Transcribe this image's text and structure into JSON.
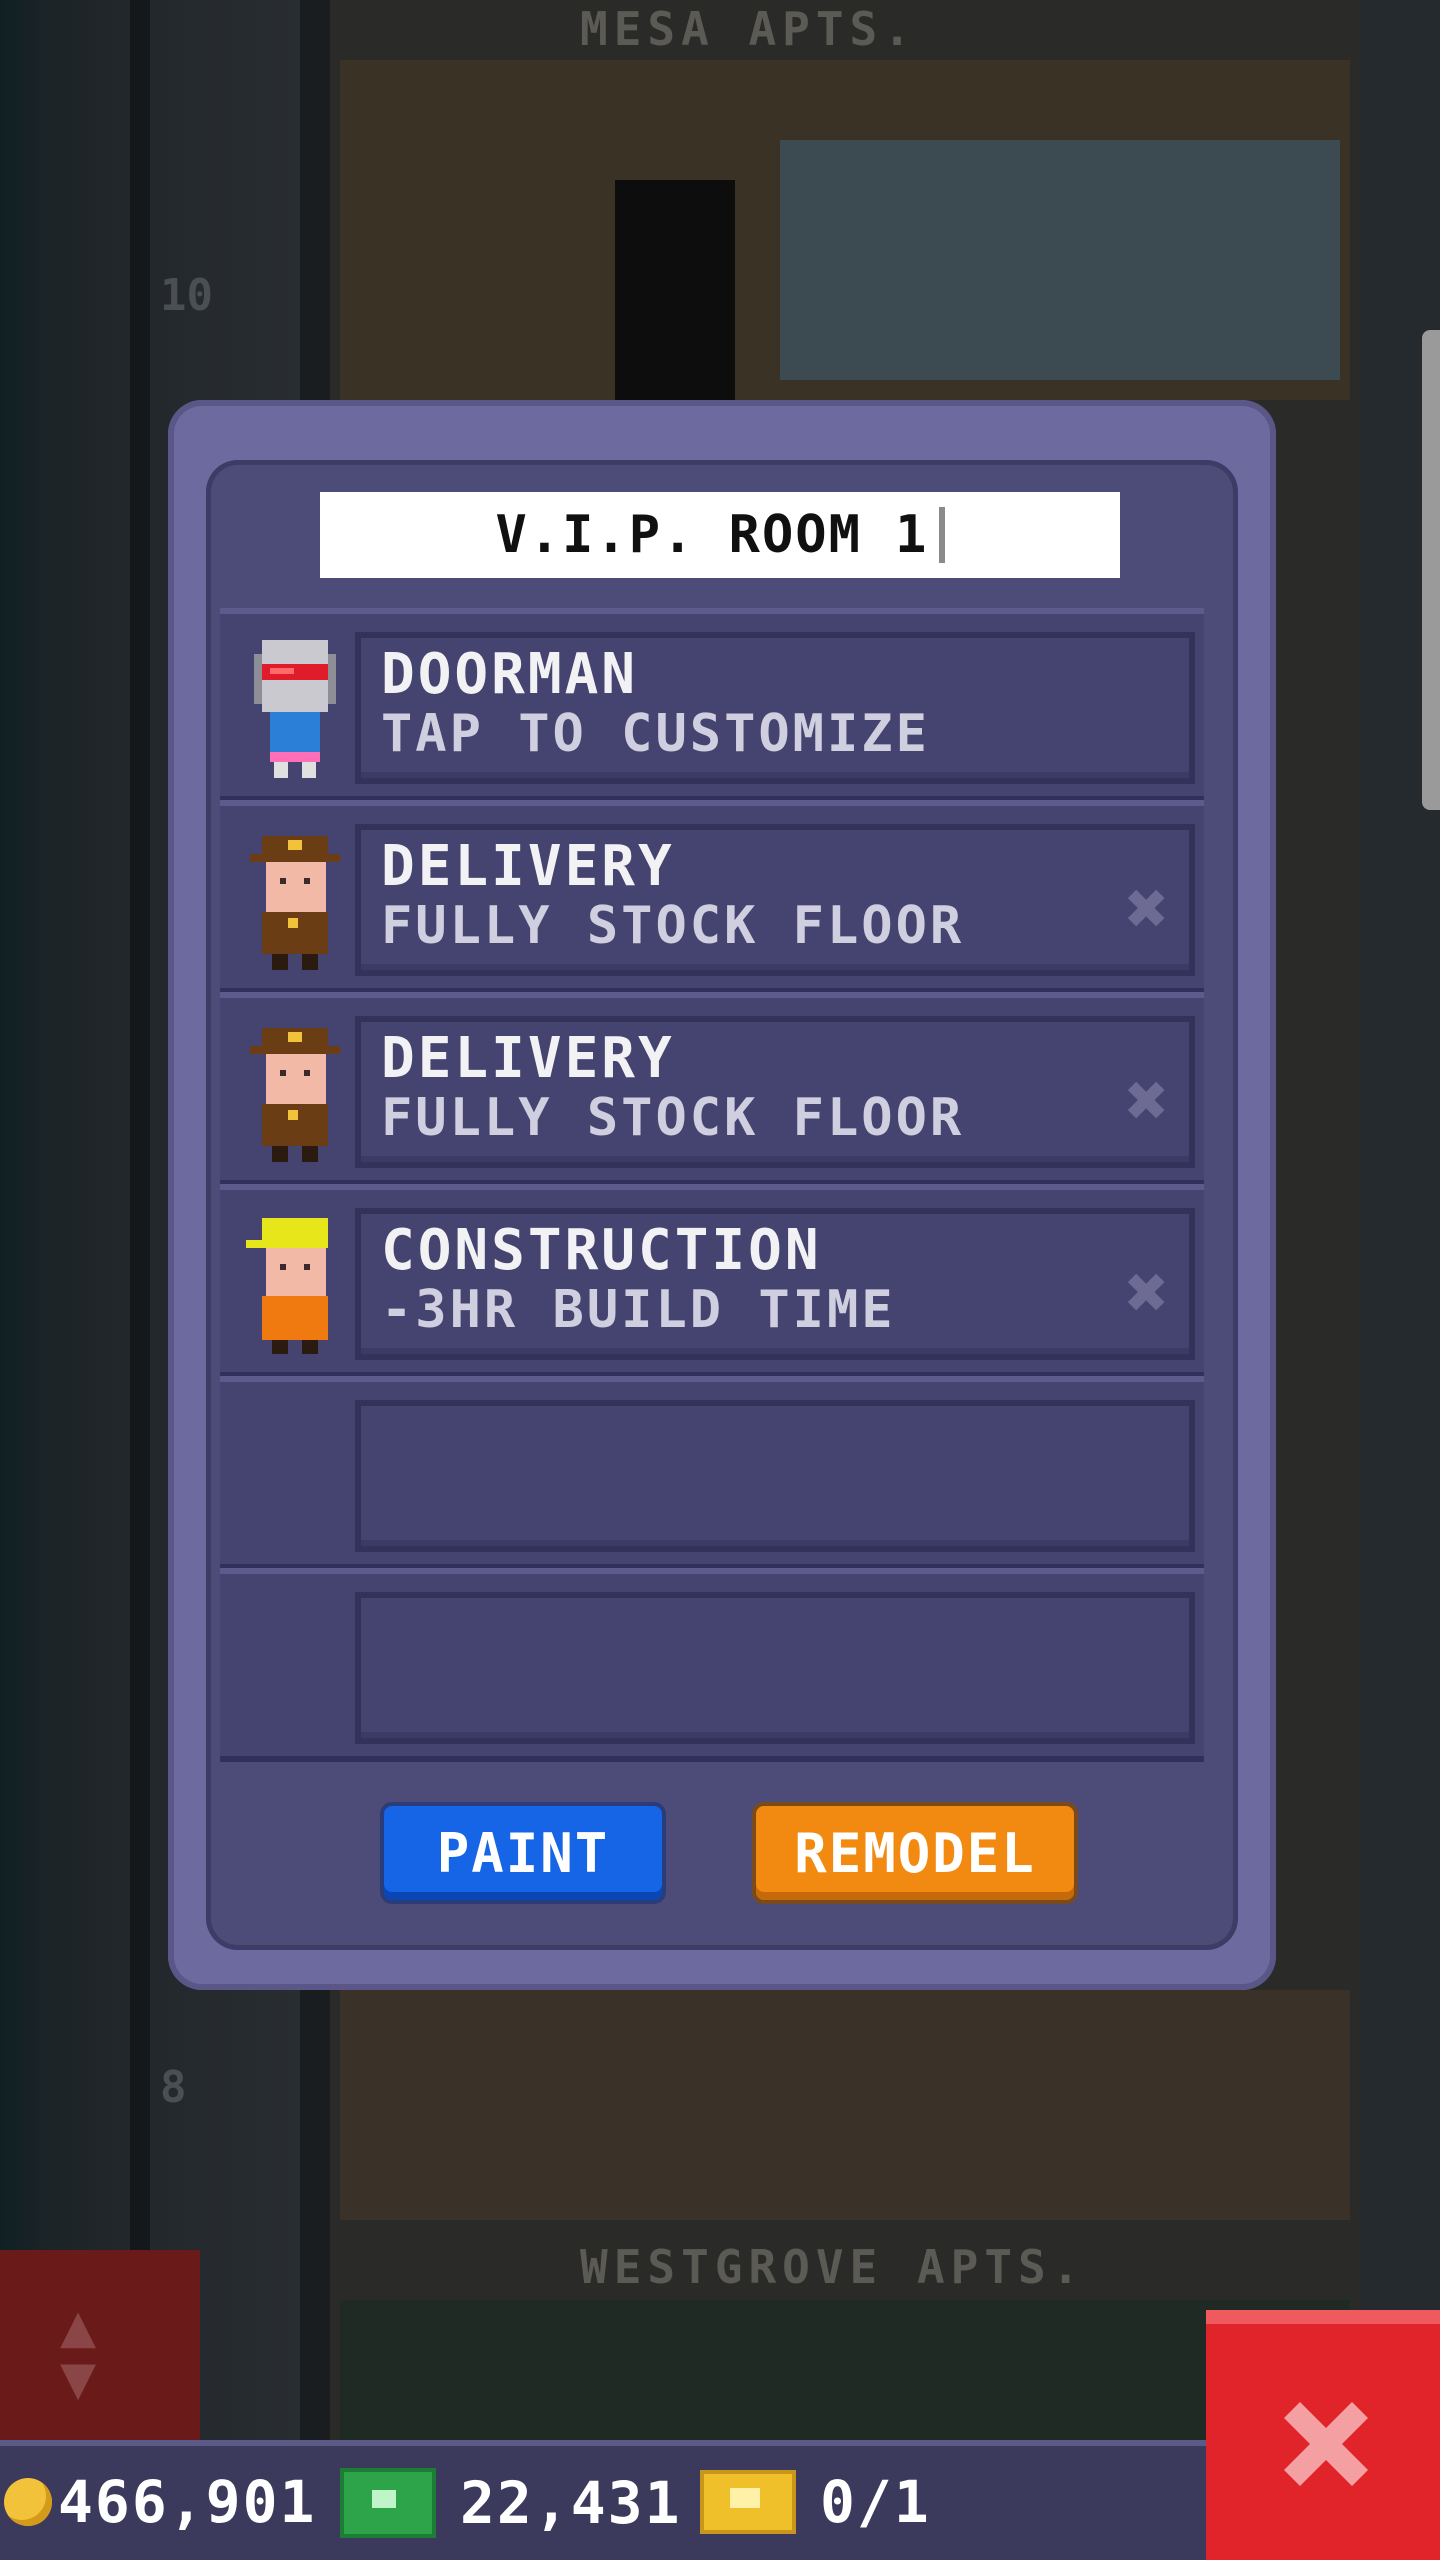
{
  "background": {
    "top_floor_label": "MESA APTS.",
    "top_floor_number": "10",
    "bottom_floor_label": "WESTGROVE APTS.",
    "bottom_floor_number": "8"
  },
  "dialog": {
    "title": "V.I.P. ROOM 1",
    "rows": [
      {
        "role": "DOORMAN",
        "effect": "TAP TO CUSTOMIZE",
        "icon": "doorman-robot-icon",
        "removable": false
      },
      {
        "role": "DELIVERY",
        "effect": "FULLY STOCK FLOOR",
        "icon": "delivery-person-icon",
        "removable": true
      },
      {
        "role": "DELIVERY",
        "effect": "FULLY STOCK FLOOR",
        "icon": "delivery-person-icon",
        "removable": true
      },
      {
        "role": "CONSTRUCTION",
        "effect": "-3HR BUILD TIME",
        "icon": "construction-worker-icon",
        "removable": true
      },
      {
        "role": "",
        "effect": "",
        "icon": "",
        "removable": false
      },
      {
        "role": "",
        "effect": "",
        "icon": "",
        "removable": false
      }
    ],
    "remove_glyph": "✖",
    "paint_label": "PAINT",
    "remodel_label": "REMODEL"
  },
  "statusbar": {
    "coins": "466,901",
    "bux": "22,431",
    "vip": "0/1"
  },
  "colors": {
    "dialog_bg": "#4d4b78",
    "paint_button": "#1565e6",
    "remodel_button": "#f28a12",
    "close_button": "#e0242a"
  }
}
